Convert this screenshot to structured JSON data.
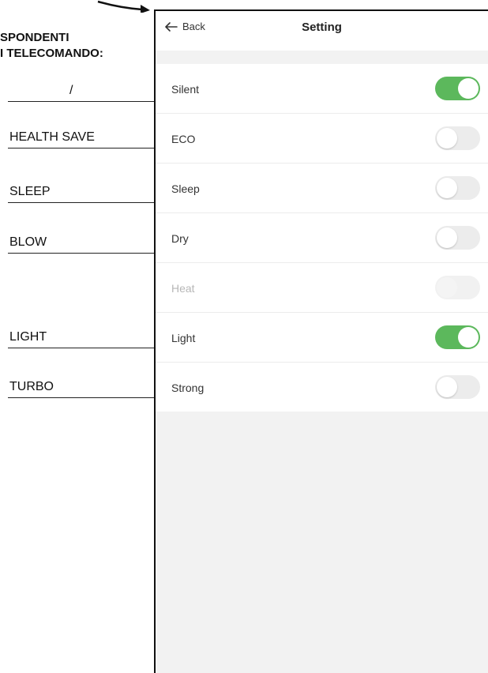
{
  "manual": {
    "heading_line1": "SPONDENTI",
    "heading_line2": "I TELECOMANDO:",
    "labels": [
      "/",
      "HEALTH SAVE",
      "SLEEP",
      "BLOW",
      "",
      "LIGHT",
      "TURBO"
    ]
  },
  "screen": {
    "back_label": "Back",
    "title": "Setting",
    "accent_color": "#5cb85c",
    "settings": [
      {
        "label": "Silent",
        "on": true,
        "disabled": false
      },
      {
        "label": "ECO",
        "on": false,
        "disabled": false
      },
      {
        "label": "Sleep",
        "on": false,
        "disabled": false
      },
      {
        "label": "Dry",
        "on": false,
        "disabled": false
      },
      {
        "label": "Heat",
        "on": false,
        "disabled": true
      },
      {
        "label": "Light",
        "on": true,
        "disabled": false
      },
      {
        "label": "Strong",
        "on": false,
        "disabled": false
      }
    ]
  }
}
